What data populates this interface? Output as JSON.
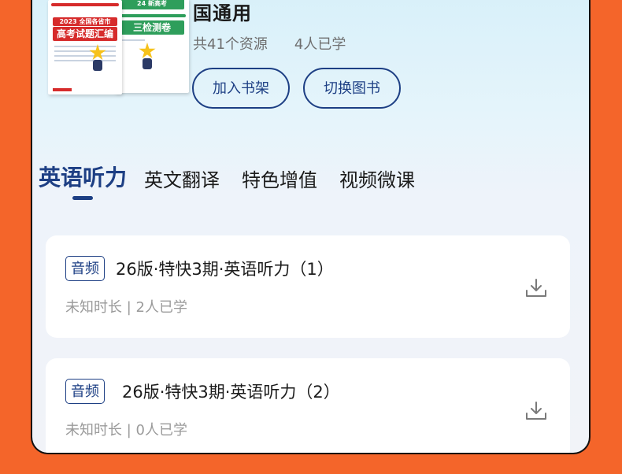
{
  "book": {
    "title": "国通用",
    "resource_count": "共41个资源",
    "learners": "4人已学",
    "cover_front": {
      "band_text": "高考试题汇编",
      "subband_text": "2023 全国各省市"
    },
    "cover_back": {
      "band_text": "三检测卷",
      "subband_text": "24 新高考"
    }
  },
  "actions": {
    "add_shelf": "加入书架",
    "switch_book": "切换图书"
  },
  "tabs": [
    {
      "label": "英语听力",
      "active": true
    },
    {
      "label": "英文翻译",
      "active": false
    },
    {
      "label": "特色增值",
      "active": false
    },
    {
      "label": "视频微课",
      "active": false
    }
  ],
  "items": [
    {
      "badge": "音频",
      "title": "26版·特快3期·英语听力（1）",
      "meta": "未知时长 | 2人已学"
    },
    {
      "badge": "音频",
      "title": "26版·特快3期·英语听力（2）",
      "meta": "未知时长 | 0人已学"
    }
  ],
  "colors": {
    "page_background": "#F4652A",
    "accent": "#1D3F84",
    "panel_top": "#D7F0F9",
    "card": "#FFFFFF"
  }
}
